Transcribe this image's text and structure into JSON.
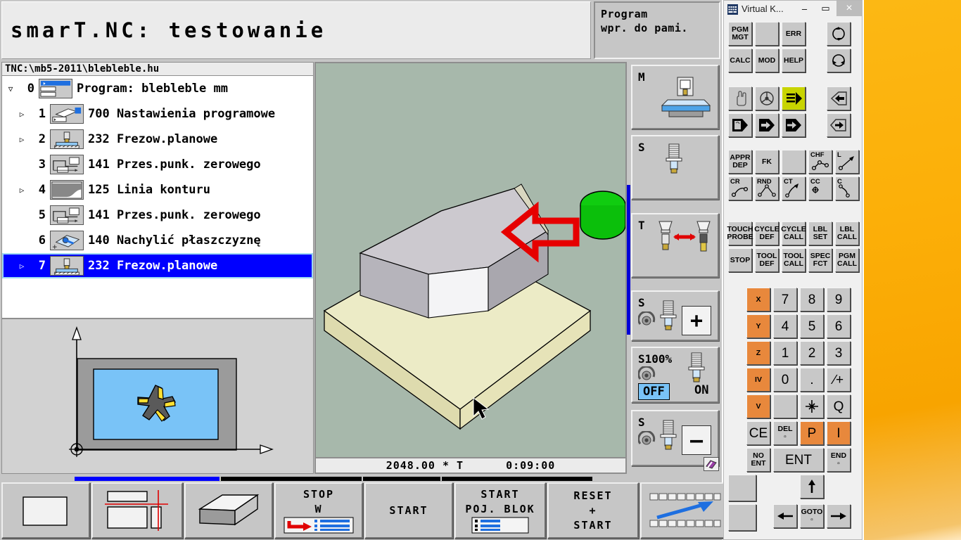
{
  "app": {
    "title": "smarT.NC: testowanie",
    "mode_line1": "Program",
    "mode_line2": "wpr. do pami."
  },
  "file": {
    "path": "TNC:\\mb5-2011\\blebleble.hu"
  },
  "tree": {
    "rows": [
      {
        "idx": "0",
        "expander": "▽",
        "icon": "program-header-icon",
        "label": "Program: blebleble mm",
        "selected": false
      },
      {
        "idx": "1",
        "expander": "▷",
        "icon": "program-settings-icon",
        "label": "700 Nastawienia programowe",
        "selected": false
      },
      {
        "idx": "2",
        "expander": "▷",
        "icon": "face-milling-icon",
        "label": "232 Frezow.planowe",
        "selected": false
      },
      {
        "idx": "3",
        "expander": "",
        "icon": "datum-shift-icon",
        "label": "141 Przes.punk. zerowego",
        "selected": false
      },
      {
        "idx": "4",
        "expander": "▷",
        "icon": "contour-line-icon",
        "label": "125 Linia konturu",
        "selected": false
      },
      {
        "idx": "5",
        "expander": "",
        "icon": "datum-shift-icon",
        "label": "141 Przes.punk. zerowego",
        "selected": false
      },
      {
        "idx": "6",
        "expander": "",
        "icon": "tilt-plane-icon",
        "label": "140 Nachylić płaszczyznę",
        "selected": false
      },
      {
        "idx": "7",
        "expander": "▷",
        "icon": "face-milling-icon",
        "label": "232 Frezow.planowe",
        "selected": true
      }
    ]
  },
  "simulation": {
    "status_value": "2048.00  *  T",
    "status_time": "0:09:00"
  },
  "vertical_softkeys": [
    {
      "label": "M",
      "icon": "machine-table-icon"
    },
    {
      "label": "S",
      "icon": "spindle-tool-icon"
    },
    {
      "label": "T",
      "icon": "tool-change-icon"
    },
    {
      "label": "S",
      "icon": "spindle-plus-icon",
      "button": "+"
    },
    {
      "label": "S100%",
      "icon": "spindle-override-icon",
      "off": "OFF",
      "on": "ON"
    },
    {
      "label": "S",
      "icon": "spindle-minus-icon",
      "button": "—"
    }
  ],
  "bottom_softkeys": [
    {
      "name": "blank-view-key",
      "lines": [],
      "icon": "blank-window-icon"
    },
    {
      "name": "split-view-key",
      "lines": [],
      "icon": "split-screen-icon"
    },
    {
      "name": "solid-view-key",
      "lines": [],
      "icon": "solid-block-icon"
    },
    {
      "name": "stop-at-key",
      "lines": [
        "STOP",
        "W"
      ],
      "icon": "stop-at-block-icon"
    },
    {
      "name": "start-key",
      "lines": [
        "START"
      ],
      "icon": ""
    },
    {
      "name": "start-single-block-key",
      "lines": [
        "START",
        "POJ. BLOK"
      ],
      "icon": "single-block-icon"
    },
    {
      "name": "reset-start-key",
      "lines": [
        "RESET",
        "+",
        "START"
      ],
      "icon": ""
    },
    {
      "name": "pan-key",
      "lines": [],
      "icon": "pan-arrow-icon"
    }
  ],
  "keyboard": {
    "window_title": "Virtual K...",
    "minimize": "–",
    "maximize": "▭",
    "close": "×",
    "keys": [
      {
        "t": "PGM\nMGT"
      },
      {
        "t": ""
      },
      {
        "t": "ERR"
      },
      {
        "t": "",
        "icon": "cw-circle-icon"
      },
      {
        "t": "CALC"
      },
      {
        "t": "MOD"
      },
      {
        "t": "HELP"
      },
      {
        "t": "",
        "icon": "ccw-circle-icon"
      },
      {
        "t": "",
        "icon": "manual-hand-icon"
      },
      {
        "t": "",
        "icon": "handwheel-icon"
      },
      {
        "t": "",
        "icon": "program-run-icon",
        "color": "green"
      },
      {
        "t": "",
        "icon": "mdi-icon"
      },
      {
        "t": "",
        "icon": "manual-positioning-icon"
      },
      {
        "t": "",
        "icon": "single-block-run-icon"
      },
      {
        "t": "",
        "icon": "full-sequence-icon"
      },
      {
        "t": "",
        "icon": "test-run-icon"
      },
      {
        "t": "APPR\nDEP"
      },
      {
        "t": "FK"
      },
      {
        "t": ""
      },
      {
        "t": "CHF",
        "icon": "chamfer-icon"
      },
      {
        "t": "L",
        "icon": "line-icon"
      },
      {
        "t": "CR",
        "icon": "radius-icon"
      },
      {
        "t": "RND",
        "icon": "round-icon"
      },
      {
        "t": "CT",
        "icon": "tangent-arc-icon"
      },
      {
        "t": "CC",
        "icon": "circle-center-icon"
      },
      {
        "t": "C",
        "icon": "circle-icon"
      },
      {
        "t": "TOUCH\nPROBE"
      },
      {
        "t": "CYCLE\nDEF"
      },
      {
        "t": "CYCLE\nCALL"
      },
      {
        "t": "LBL\nSET"
      },
      {
        "t": "LBL\nCALL"
      },
      {
        "t": "STOP"
      },
      {
        "t": "TOOL\nDEF"
      },
      {
        "t": "TOOL\nCALL"
      },
      {
        "t": "SPEC\nFCT"
      },
      {
        "t": "PGM\nCALL"
      },
      {
        "t": "X",
        "color": "orange"
      },
      {
        "t": "7",
        "num": true
      },
      {
        "t": "8",
        "num": true
      },
      {
        "t": "9",
        "num": true
      },
      {
        "t": "Y",
        "color": "orange"
      },
      {
        "t": "4",
        "num": true
      },
      {
        "t": "5",
        "num": true
      },
      {
        "t": "6",
        "num": true
      },
      {
        "t": "Z",
        "color": "orange"
      },
      {
        "t": "1",
        "num": true
      },
      {
        "t": "2",
        "num": true
      },
      {
        "t": "3",
        "num": true
      },
      {
        "t": "IV",
        "color": "orange"
      },
      {
        "t": "0",
        "num": true
      },
      {
        "t": ".",
        "num": true
      },
      {
        "t": "∕+",
        "num": true
      },
      {
        "t": "V",
        "color": "orange"
      },
      {
        "t": ""
      },
      {
        "t": "",
        "icon": "actual-position-icon"
      },
      {
        "t": "Q",
        "num": true
      },
      {
        "t": "CE",
        "num": true
      },
      {
        "t": "DEL\n▫"
      },
      {
        "t": "P",
        "color": "orange",
        "num": true
      },
      {
        "t": "I",
        "color": "orange",
        "num": true
      },
      {
        "t": "NO\nENT"
      },
      {
        "t": "ENT",
        "num": true
      },
      {
        "t": "END\n▫"
      },
      {
        "t": ""
      },
      {
        "t": ""
      },
      {
        "t": "",
        "icon": "arrow-up-icon"
      },
      {
        "t": "",
        "icon": "arrow-left-icon"
      },
      {
        "t": "GOTO\n▫"
      },
      {
        "t": "",
        "icon": "arrow-right-icon"
      }
    ]
  },
  "colors": {
    "selection_blue": "#0000ff",
    "sim_background": "#a7b8ab",
    "panel_gray": "#c6c6c6",
    "axis_orange": "#e8883c",
    "mode_green": "#c8d400",
    "wallpaper_amber": "#fcb814"
  }
}
